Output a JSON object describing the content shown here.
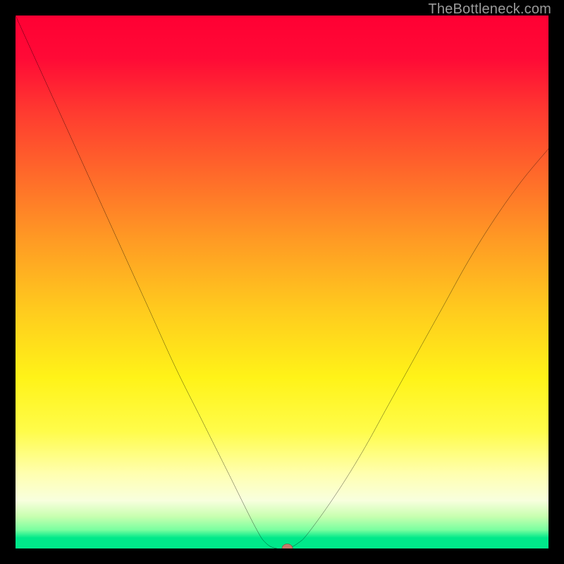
{
  "watermark": "TheBottleneck.com",
  "chart_data": {
    "type": "line",
    "title": "",
    "xlabel": "",
    "ylabel": "",
    "xlim": [
      0,
      100
    ],
    "ylim": [
      0,
      100
    ],
    "grid": false,
    "legend": false,
    "series": [
      {
        "name": "bottleneck-curve",
        "x": [
          0,
          5,
          10,
          15,
          20,
          25,
          30,
          35,
          40,
          45,
          47,
          49,
          51,
          53,
          55,
          60,
          65,
          70,
          75,
          80,
          85,
          90,
          95,
          100
        ],
        "values": [
          100,
          89,
          78,
          67,
          56,
          45,
          34,
          24,
          14,
          4,
          1,
          0,
          0,
          1,
          3,
          10,
          18,
          27,
          36,
          45,
          54,
          62,
          69,
          75
        ]
      }
    ],
    "marker": {
      "name": "optimal-point",
      "x": 51,
      "y": 0,
      "color": "#c77b6a"
    },
    "background_gradient": {
      "top": "#ff0033",
      "mid": "#ffee18",
      "bottom": "#00e88a"
    }
  }
}
